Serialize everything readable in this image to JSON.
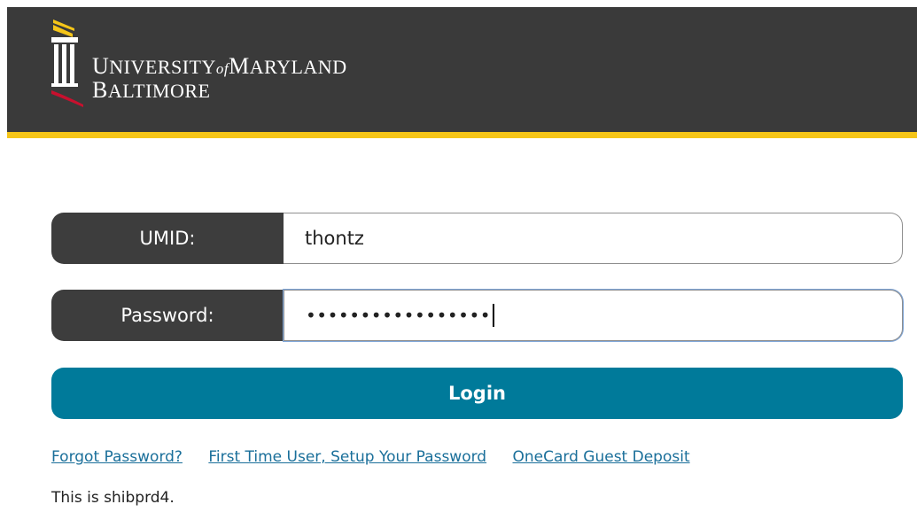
{
  "header": {
    "logo": {
      "line1_first": "U",
      "line1_rest": "NIVERSITY",
      "line1_of": "of",
      "line1_second": "M",
      "line1_second_rest": "ARYLAND",
      "line2_first": "B",
      "line2_rest": "ALTIMORE"
    },
    "colors": {
      "header_bg": "#3a3a3a",
      "stripe": "#f5c518",
      "logo_red": "#c8102e"
    }
  },
  "form": {
    "umid": {
      "label": "UMID:",
      "value": "thontz"
    },
    "password": {
      "label": "Password:",
      "value": "•••••••••••••••••"
    },
    "login_label": "Login",
    "colors": {
      "label_bg": "#3d3d3d",
      "button_bg": "#007a9a"
    }
  },
  "links": [
    "Forgot Password?",
    "First Time User, Setup Your Password",
    "OneCard Guest Deposit"
  ],
  "footer_note": "This is shibprd4."
}
